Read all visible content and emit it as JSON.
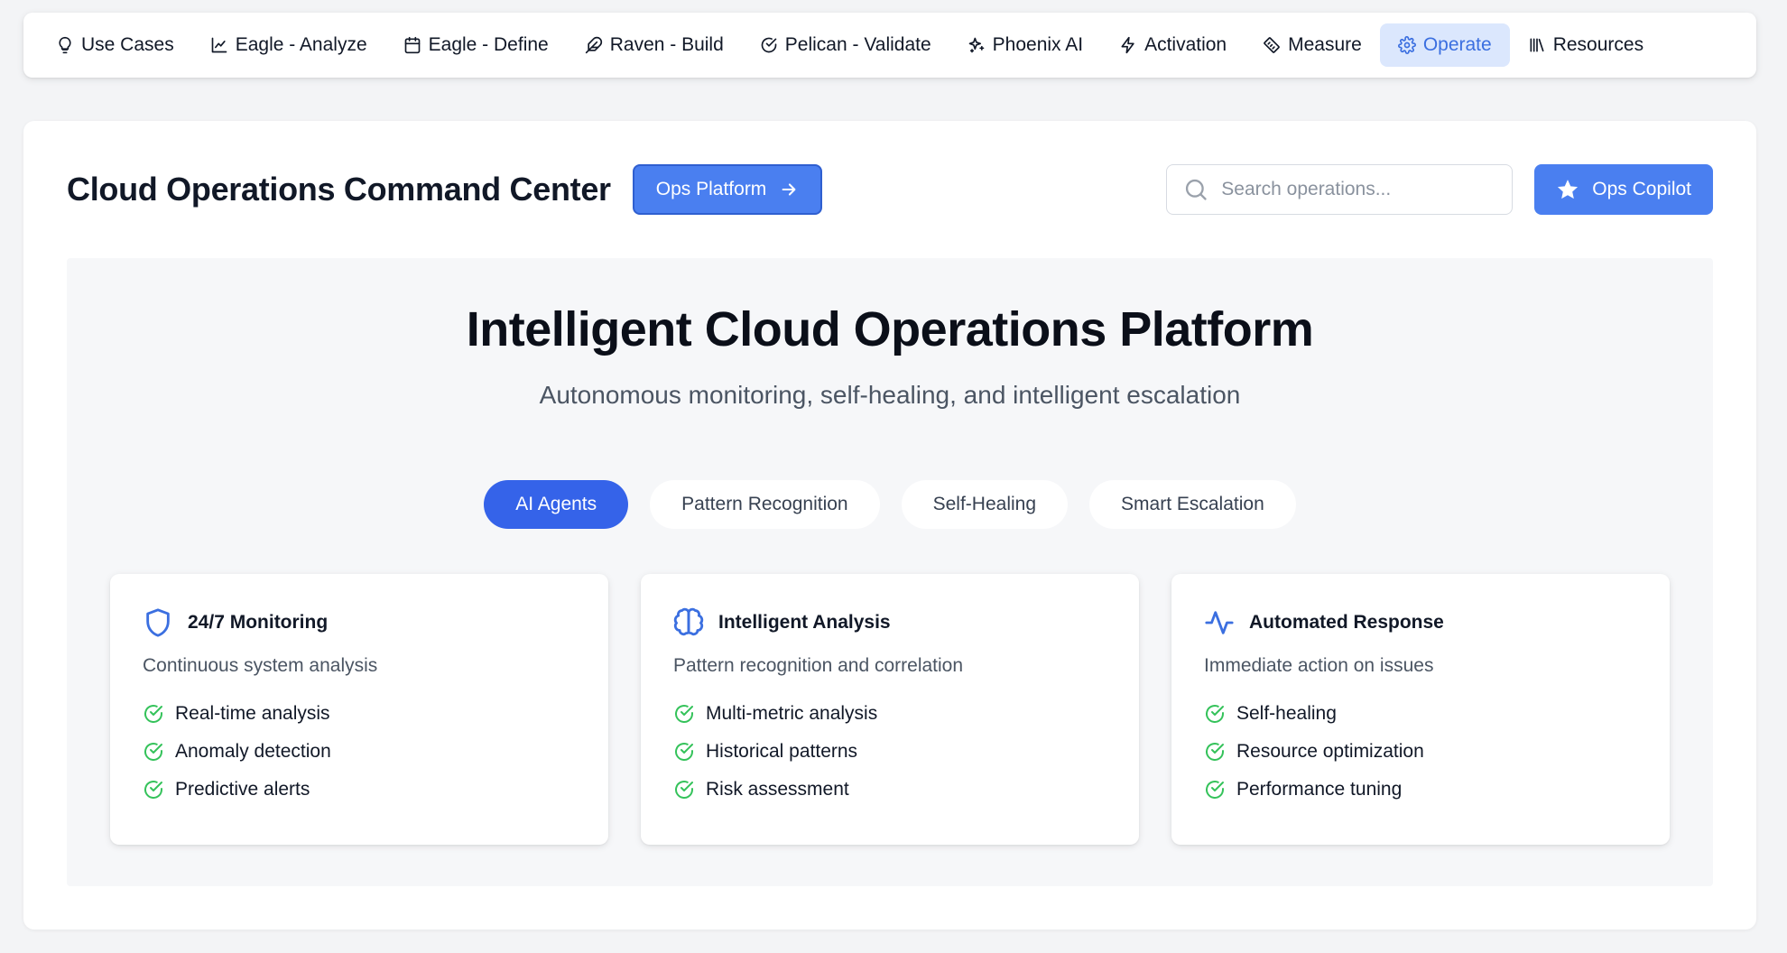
{
  "nav": {
    "items": [
      {
        "label": "Use Cases",
        "icon": "lightbulb-icon",
        "active": false
      },
      {
        "label": "Eagle - Analyze",
        "icon": "line-chart-icon",
        "active": false
      },
      {
        "label": "Eagle - Define",
        "icon": "calendar-icon",
        "active": false
      },
      {
        "label": "Raven - Build",
        "icon": "feather-icon",
        "active": false
      },
      {
        "label": "Pelican - Validate",
        "icon": "check-circle-icon",
        "active": false
      },
      {
        "label": "Phoenix AI",
        "icon": "sparkles-icon",
        "active": false
      },
      {
        "label": "Activation",
        "icon": "lightning-icon",
        "active": false
      },
      {
        "label": "Measure",
        "icon": "ruler-icon",
        "active": false
      },
      {
        "label": "Operate",
        "icon": "gear-icon",
        "active": true
      },
      {
        "label": "Resources",
        "icon": "library-icon",
        "active": false
      }
    ]
  },
  "header": {
    "title": "Cloud Operations Command Center",
    "ops_platform_label": "Ops Platform",
    "search_placeholder": "Search operations...",
    "copilot_label": "Ops Copilot"
  },
  "hero": {
    "title": "Intelligent Cloud Operations Platform",
    "subtitle": "Autonomous monitoring, self-healing, and intelligent escalation",
    "tabs": [
      {
        "label": "AI Agents",
        "active": true
      },
      {
        "label": "Pattern Recognition",
        "active": false
      },
      {
        "label": "Self-Healing",
        "active": false
      },
      {
        "label": "Smart Escalation",
        "active": false
      }
    ],
    "cards": [
      {
        "icon": "shield-icon",
        "title": "24/7 Monitoring",
        "description": "Continuous system analysis",
        "features": [
          "Real-time analysis",
          "Anomaly detection",
          "Predictive alerts"
        ]
      },
      {
        "icon": "brain-icon",
        "title": "Intelligent Analysis",
        "description": "Pattern recognition and correlation",
        "features": [
          "Multi-metric analysis",
          "Historical patterns",
          "Risk assessment"
        ]
      },
      {
        "icon": "activity-icon",
        "title": "Automated Response",
        "description": "Immediate action on issues",
        "features": [
          "Self-healing",
          "Resource optimization",
          "Performance tuning"
        ]
      }
    ]
  },
  "colors": {
    "accent": "#3563e9",
    "button": "#4a7ff0",
    "active_nav_bg": "#dbe7fd",
    "check": "#34c25a"
  }
}
